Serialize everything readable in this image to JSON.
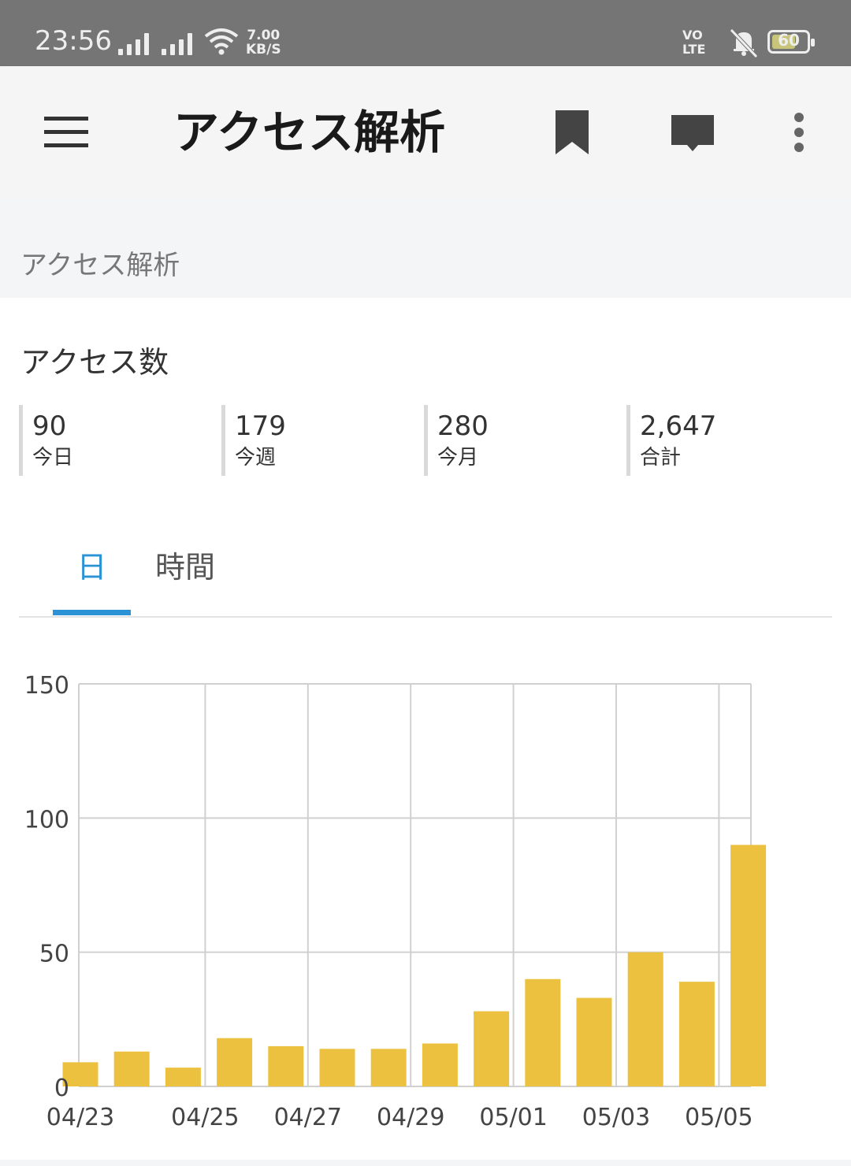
{
  "status_bar": {
    "time": "23:56",
    "speed_value": "7.00",
    "speed_unit": "KB/S",
    "volte_line1": "VO",
    "volte_line2": "LTE",
    "battery": "60"
  },
  "app_bar": {
    "title": "アクセス解析",
    "icons": [
      "menu-icon",
      "bookmark-icon",
      "comment-icon",
      "more-vert-icon"
    ]
  },
  "breadcrumb": "アクセス解析",
  "access": {
    "title": "アクセス数",
    "stats": [
      {
        "value": "90",
        "label": "今日"
      },
      {
        "value": "179",
        "label": "今週"
      },
      {
        "value": "280",
        "label": "今月"
      },
      {
        "value": "2,647",
        "label": "合計"
      }
    ]
  },
  "tabs": [
    {
      "label": "日",
      "active": true
    },
    {
      "label": "時間",
      "active": false
    }
  ],
  "colors": {
    "bar": "#ecc140",
    "accent": "#2b93d5",
    "grid": "#d0d0d0"
  },
  "chart_data": {
    "type": "bar",
    "categories": [
      "04/23",
      "04/24",
      "04/25",
      "04/26",
      "04/27",
      "04/28",
      "04/29",
      "04/30",
      "05/01",
      "05/02",
      "05/03",
      "05/04",
      "05/05",
      "05/06"
    ],
    "values": [
      9,
      13,
      7,
      18,
      15,
      14,
      14,
      16,
      28,
      40,
      33,
      50,
      39,
      90
    ],
    "x_tick_labels": [
      "04/23",
      "04/25",
      "04/27",
      "04/29",
      "05/01",
      "05/03",
      "05/05"
    ],
    "y_ticks": [
      0,
      50,
      100,
      150
    ],
    "ylim": [
      0,
      150
    ],
    "grid": true,
    "title": "",
    "xlabel": "",
    "ylabel": ""
  }
}
